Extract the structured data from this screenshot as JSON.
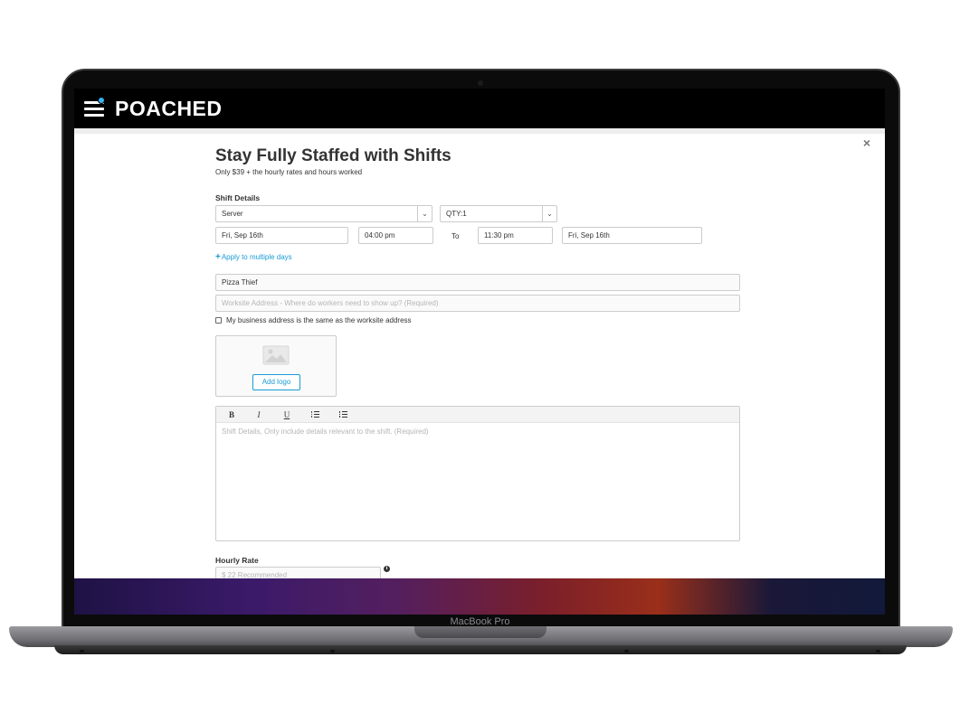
{
  "app": {
    "brand": "POACHED"
  },
  "device": {
    "model_label": "MacBook Pro"
  },
  "modal": {
    "close_glyph": "×",
    "title": "Stay Fully Staffed with Shifts",
    "subtitle": "Only $39 + the hourly rates and hours worked"
  },
  "shift": {
    "section_label": "Shift Details",
    "role": "Server",
    "quantity": "QTY:1",
    "start_date": "Fri, Sep 16th",
    "start_time": "04:00 pm",
    "to_label": "To",
    "end_time": "11:30 pm",
    "end_date": "Fri, Sep 16th",
    "apply_multiple_days": "Apply to multiple days"
  },
  "business": {
    "name": "Pizza Thief",
    "worksite_placeholder": "Worksite Address - Where do workers need to show up? (Required)",
    "same_address_label": "My business address is the same as the worksite address",
    "add_logo_label": "Add logo"
  },
  "editor": {
    "toolbar": {
      "bold": "B",
      "italic": "I",
      "underline": "U"
    },
    "placeholder": "Shift Details, Only include details relevant to the shift. (Required)"
  },
  "rate": {
    "label": "Hourly Rate",
    "placeholder": "$ 22 Recommended"
  },
  "colors": {
    "accent": "#1a9bd7",
    "notification": "#38b2f0"
  }
}
